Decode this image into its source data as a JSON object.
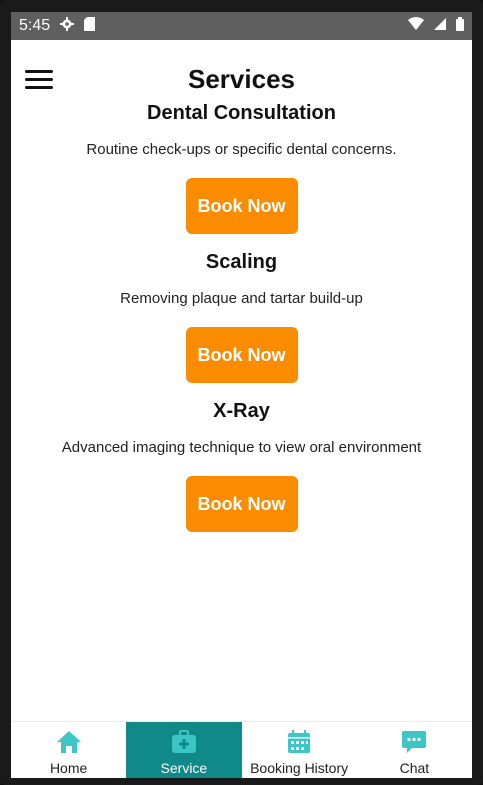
{
  "status_bar": {
    "time": "5:45"
  },
  "header": {
    "title": "Services"
  },
  "services": [
    {
      "title": "Dental Consultation",
      "description": "Routine check-ups or specific dental concerns.",
      "button_label": "Book Now"
    },
    {
      "title": "Scaling",
      "description": "Removing plaque and tartar build-up",
      "button_label": "Book Now"
    },
    {
      "title": "X-Ray",
      "description": "Advanced imaging technique to view oral environment",
      "button_label": "Book Now"
    }
  ],
  "bottom_nav": {
    "items": [
      {
        "label": "Home",
        "icon": "home-icon"
      },
      {
        "label": "Service",
        "icon": "medical-kit-icon",
        "active": true
      },
      {
        "label": "Booking History",
        "icon": "calendar-icon"
      },
      {
        "label": "Chat",
        "icon": "chat-bubble-icon"
      }
    ]
  },
  "colors": {
    "accent": "#fb8c00",
    "nav_active": "#0f8a89",
    "icon": "#3ec6c6"
  }
}
